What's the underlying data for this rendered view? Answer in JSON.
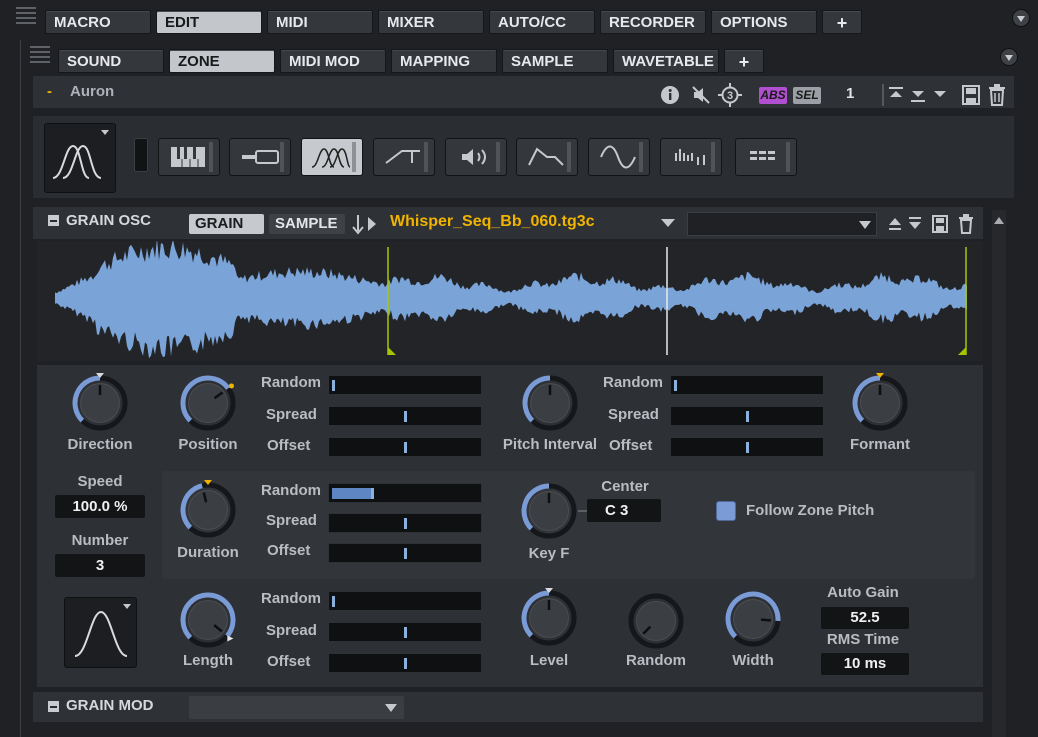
{
  "main_tabs": [
    "MACRO",
    "EDIT",
    "MIDI",
    "MIXER",
    "AUTO/CC",
    "RECORDER",
    "OPTIONS",
    "+"
  ],
  "sub_tabs": [
    "SOUND",
    "ZONE",
    "MIDI MOD",
    "MAPPING",
    "SAMPLE",
    "WAVETABLE",
    "+"
  ],
  "zone": {
    "dash": "-",
    "name": "Auron",
    "abs_label": "ABS",
    "sel_label": "SEL",
    "layer_number": "1"
  },
  "grain_osc": {
    "section_title": "GRAIN OSC",
    "grain_button": "GRAIN",
    "sample_button": "SAMPLE",
    "filename": "Whisper_Seq_Bb_060.tg3c",
    "secondary_dropdown_value": ""
  },
  "controls": {
    "direction_label": "Direction",
    "position_label": "Position",
    "pitch_interval_label": "Pitch Interval",
    "formant_label": "Formant",
    "speed_label": "Speed",
    "speed_value": "100.0 %",
    "number_label": "Number",
    "number_value": "3",
    "duration_label": "Duration",
    "keyf_label": "Key F",
    "center_label": "Center",
    "center_value": "C  3",
    "follow_zone_pitch_label": "Follow Zone Pitch",
    "length_label": "Length",
    "level_label": "Level",
    "random_knob_label": "Random",
    "width_label": "Width",
    "auto_gain_label": "Auto Gain",
    "auto_gain_value": "52.5",
    "rms_time_label": "RMS Time",
    "rms_time_value": "10 ms",
    "random_label": "Random",
    "spread_label": "Spread",
    "offset_label": "Offset"
  },
  "grain_mod": {
    "section_title": "GRAIN MOD",
    "dropdown_value": ""
  },
  "colors": {
    "accent_blue": "#7a9bd6",
    "filename_yellow": "#f0b400",
    "abs_purple": "#b04fd0",
    "marker_green": "#a8c400",
    "waveform": "#7aa3d8"
  },
  "icons": {
    "info": "info-icon",
    "mute": "speaker-muted-icon",
    "layer": "layer-target-icon",
    "save": "save-icon",
    "delete": "trash-icon"
  }
}
